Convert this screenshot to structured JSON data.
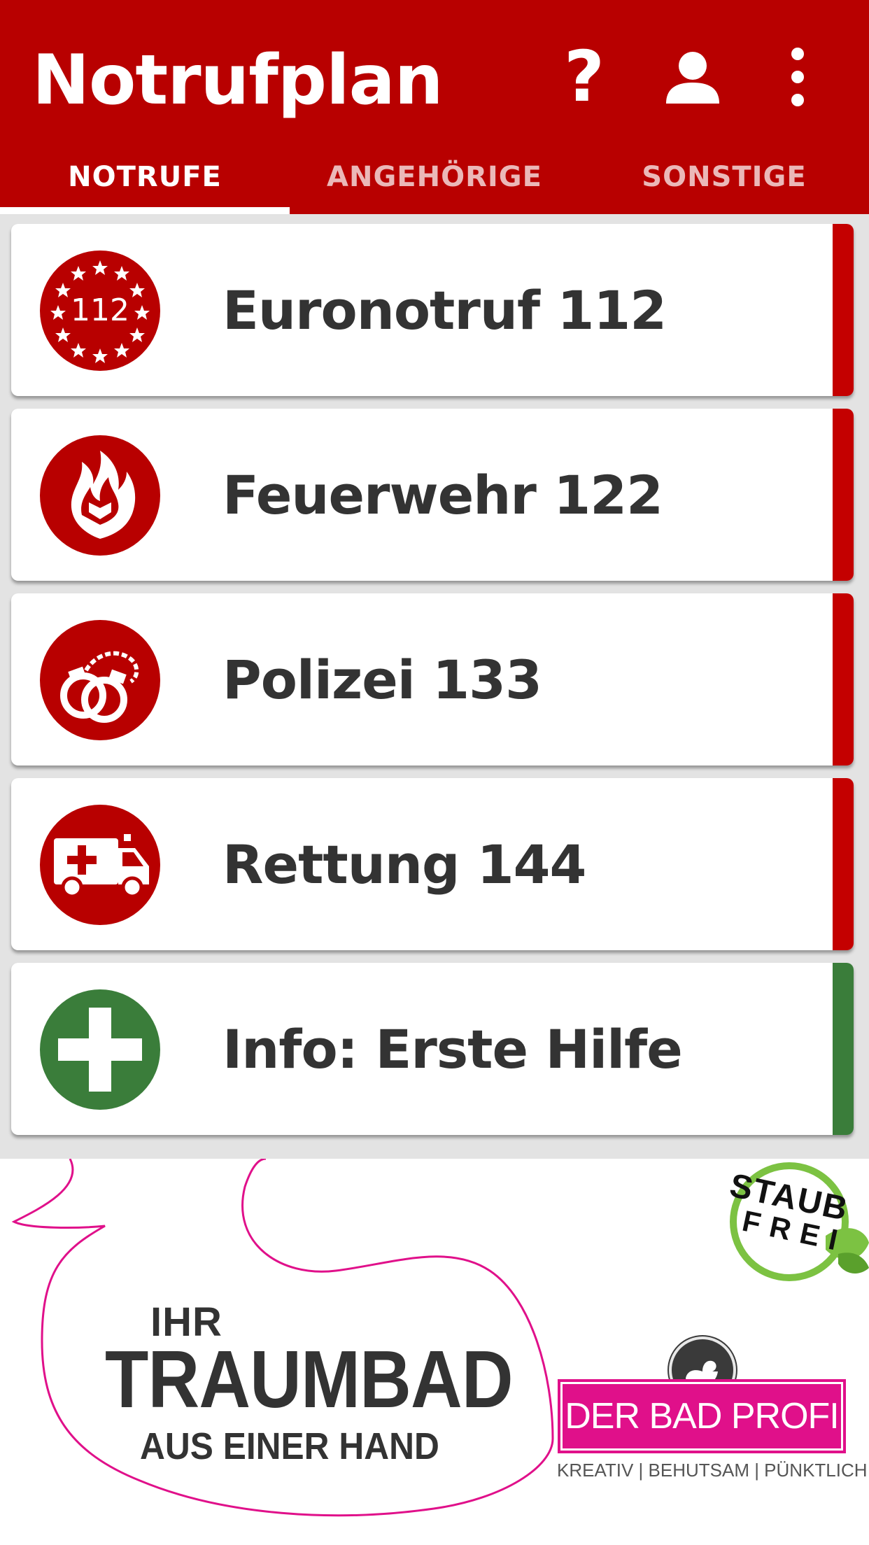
{
  "app": {
    "title": "Notrufplan",
    "colors": {
      "primary": "#b80000",
      "accent_red": "#c40000",
      "accent_green": "#3a7d3a"
    }
  },
  "toolbar": {
    "help_glyph": "?",
    "icons": [
      "help-icon",
      "account-icon",
      "more-vert-icon"
    ]
  },
  "tabs": [
    {
      "label": "NOTRUFE",
      "active": true
    },
    {
      "label": "ANGEHÖRIGE",
      "active": false
    },
    {
      "label": "SONSTIGE",
      "active": false
    }
  ],
  "emergency_list": [
    {
      "label": "Euronotruf 112",
      "icon": "euro-emergency-112-icon",
      "icon_text": "112",
      "accent": "red"
    },
    {
      "label": "Feuerwehr 122",
      "icon": "fire-icon",
      "accent": "red"
    },
    {
      "label": "Polizei 133",
      "icon": "handcuffs-icon",
      "accent": "red"
    },
    {
      "label": "Rettung 144",
      "icon": "ambulance-icon",
      "accent": "red"
    },
    {
      "label": "Info: Erste Hilfe",
      "icon": "first-aid-cross-icon",
      "accent": "green"
    }
  ],
  "ad": {
    "line1": "IHR",
    "line2": "TRAUMBAD",
    "line3": "AUS EINER HAND",
    "badge": {
      "line1": "STAUB",
      "line2": "FREI"
    },
    "brand": "DER BAD PROFI",
    "tagline": "KREATIV | BEHUTSAM | PÜNKTLICH",
    "colors": {
      "brand_pink": "#e0108a",
      "outline_pink": "#e0108a",
      "badge_green": "#7cc242"
    }
  }
}
